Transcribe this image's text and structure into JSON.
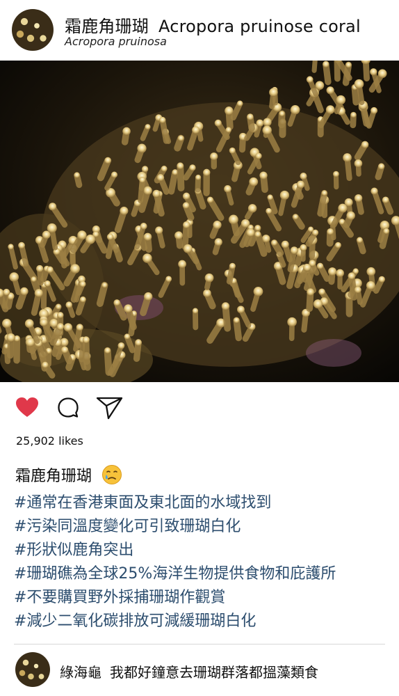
{
  "post": {
    "title_zh": "霜鹿角珊瑚",
    "title_en": "Acropora pruinose coral",
    "subtitle": "Acropora pruinosa",
    "likes": "25,902 likes"
  },
  "actions": {
    "liked": true,
    "like_color": "#e0384a",
    "icons": [
      "heart-icon",
      "comment-icon",
      "share-icon"
    ]
  },
  "caption": {
    "title": "霜鹿角珊瑚",
    "emoji": "crying-face-emoji",
    "tags": [
      "#通常在香港東面及東北面的水域找到",
      "#污染同溫度變化可引致珊瑚白化",
      "#形狀似鹿角突出",
      "#珊瑚礁為全球25%海洋生物提供食物和庇護所",
      "#不要購買野外採捕珊瑚作觀賞",
      "#減少二氧化碳排放可減緩珊瑚白化"
    ]
  },
  "comment": {
    "author": "綠海龜",
    "text": "我都好鐘意去珊瑚群落都搵藻類食"
  },
  "colors": {
    "hashtag": "#2c4d6e",
    "photo_bg": "#0d0b07"
  }
}
